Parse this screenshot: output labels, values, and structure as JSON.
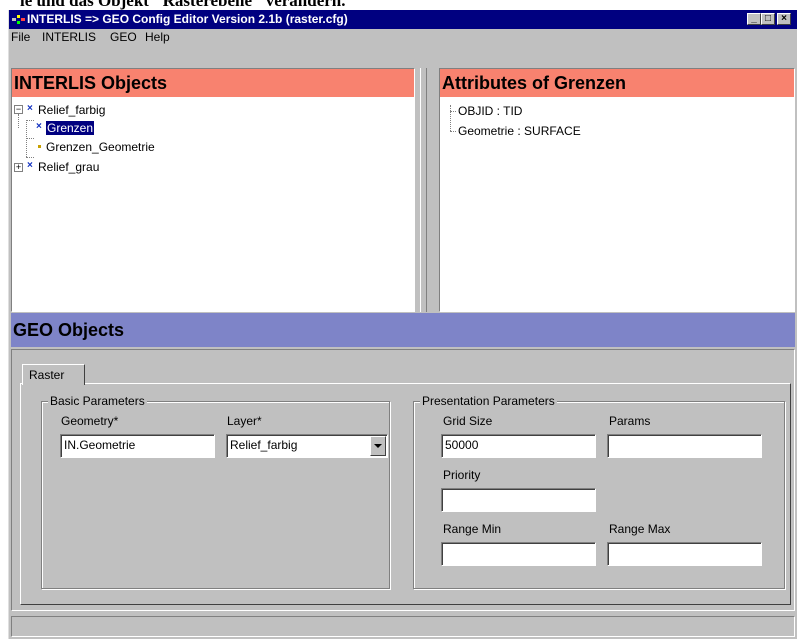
{
  "background_caption": "le und das Objekt \"Rasterebene\" verändern.",
  "window": {
    "title": "INTERLIS => GEO Config Editor Version 2.1b (raster.cfg)",
    "buttons": {
      "minimize": "_",
      "maximize": "□",
      "close": "×"
    }
  },
  "menu": [
    "File",
    "INTERLIS",
    "GEO",
    "Help"
  ],
  "interlis_panel": {
    "title": "INTERLIS Objects",
    "tree": [
      {
        "label": "Relief_farbig",
        "expander": "−",
        "icon": "object-icon"
      },
      {
        "label": "Grenzen",
        "icon": "object-icon",
        "selected": true
      },
      {
        "label": "Grenzen_Geometrie",
        "icon": "attribute-icon"
      },
      {
        "label": "Relief_grau",
        "expander": "+",
        "icon": "object-icon"
      }
    ]
  },
  "attributes_panel": {
    "title": "Attributes of Grenzen",
    "items": [
      "OBJID : TID",
      "Geometrie : SURFACE"
    ]
  },
  "geo_panel": {
    "title": "GEO Objects",
    "tab": "Raster",
    "basic": {
      "legend": "Basic Parameters",
      "geometry_label": "Geometry*",
      "geometry_value": "IN.Geometrie",
      "layer_label": "Layer*",
      "layer_value": "Relief_farbig"
    },
    "presentation": {
      "legend": "Presentation Parameters",
      "grid_size_label": "Grid Size",
      "grid_size_value": "50000",
      "params_label": "Params",
      "params_value": "",
      "priority_label": "Priority",
      "priority_value": "",
      "range_min_label": "Range Min",
      "range_min_value": "",
      "range_max_label": "Range Max",
      "range_max_value": ""
    }
  },
  "colors": {
    "titlebar": "#000080",
    "interlis_header": "#f8826f",
    "geo_header": "#7e84c8",
    "face": "#c0c0c0"
  }
}
